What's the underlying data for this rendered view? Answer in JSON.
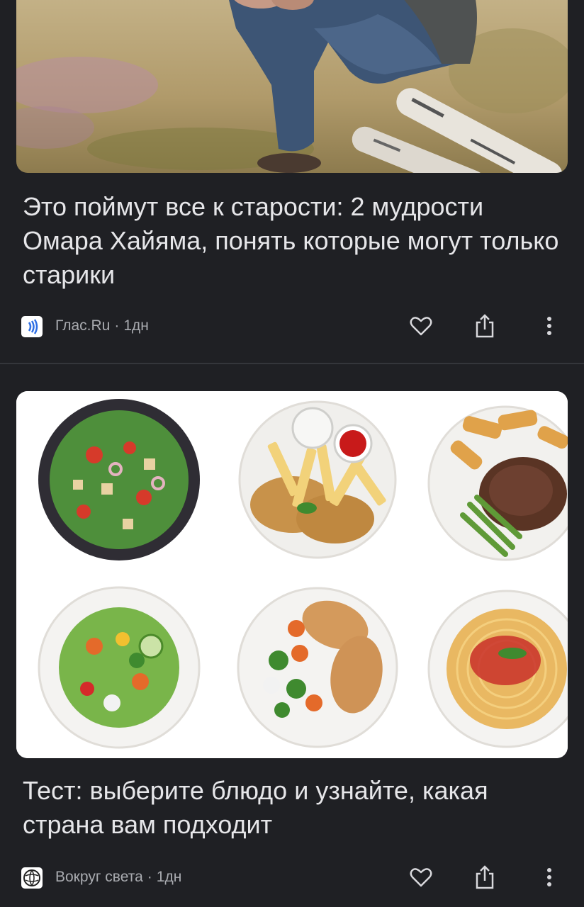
{
  "feed": [
    {
      "headline": "Это поймут все к старости: 2 мудрости Омара Хайяма, понять которые могут только старики",
      "source": "Глас.Ru",
      "age": "1дн",
      "source_icon": "sound-wave-icon",
      "image": "man-sitting-on-birch-logs"
    },
    {
      "headline": "Тест: выберите блюдо и узнайте, какая страна вам подходит",
      "source": "Вокруг света",
      "age": "1дн",
      "source_icon": "globe-logo-icon",
      "image": "six-plates-of-food"
    }
  ],
  "separator": "·",
  "actions": {
    "like_icon": "heart-icon",
    "share_icon": "share-icon",
    "more_icon": "more-vert-icon"
  },
  "colors": {
    "background": "#1f2024",
    "text": "#e6e6e9",
    "meta": "#a9abb0",
    "accent": "#2f6fe4"
  }
}
